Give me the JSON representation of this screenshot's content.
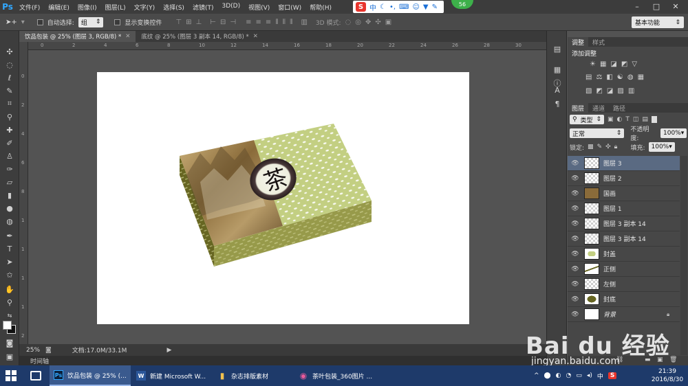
{
  "menubar": {
    "logo": "Ps",
    "items": [
      "文件(F)",
      "编辑(E)",
      "图像(I)",
      "图层(L)",
      "文字(Y)",
      "选择(S)",
      "滤镜(T)",
      "3D(D)",
      "视图(V)",
      "窗口(W)",
      "帮助(H)"
    ],
    "ime": {
      "logo": "S",
      "mode": "中"
    },
    "notification_count": "56",
    "window_controls": [
      "–",
      "□",
      "✕"
    ]
  },
  "options": {
    "auto_select_label": "自动选择:",
    "auto_select_value": "组",
    "show_transform_label": "显示变换控件",
    "mode_3d_label": "3D 模式:",
    "workspace": "基本功能"
  },
  "tabs": [
    {
      "label": "饮品包装 @ 25% (图层 3, RGB/8) *",
      "active": true
    },
    {
      "label": "底纹 @ 25% (图层 3 副本 14, RGB/8) *",
      "active": false
    }
  ],
  "rulers": {
    "top": [
      "0",
      "2",
      "4",
      "6",
      "8",
      "10",
      "12",
      "14",
      "16",
      "18",
      "20",
      "22",
      "24",
      "26",
      "28",
      "30",
      "32"
    ],
    "left": [
      "0",
      "2",
      "4",
      "6",
      "8",
      "1",
      "1",
      "1",
      "1",
      "2"
    ]
  },
  "canvas": {
    "box_lid_color": "#c3cf82",
    "box_side_color": "#676622",
    "box_front_color": "#979a4a",
    "seal_char": "茶"
  },
  "status": {
    "zoom": "25%",
    "doc": "文档:17.0M/33.1M"
  },
  "timeline_label": "时间轴",
  "adjust_panel": {
    "tabs": [
      "调整",
      "样式"
    ],
    "title": "添加调整",
    "row1": [
      "☀",
      "▦",
      "◪",
      "◩",
      "▽"
    ],
    "row2": [
      "▤",
      "⚖",
      "◧",
      "☯",
      "◍",
      "▦"
    ],
    "row3": [
      "▧",
      "◩",
      "◪",
      "▨",
      "▥"
    ]
  },
  "layers_panel": {
    "tabs": [
      "图层",
      "通道",
      "路径"
    ],
    "filter": "类型",
    "blend_mode": "正常",
    "opacity_label": "不透明度:",
    "opacity": "100%",
    "lock_label": "锁定:",
    "fill_label": "填充:",
    "fill": "100%",
    "layers": [
      {
        "name": "图层 3",
        "active": true
      },
      {
        "name": "图层 2",
        "active": false
      },
      {
        "name": "国画",
        "active": false
      },
      {
        "name": "图层 1",
        "active": false
      },
      {
        "name": "图层 3 副本 14",
        "active": false
      },
      {
        "name": "图层 3 副本 14",
        "active": false
      },
      {
        "name": "封盖",
        "active": false
      },
      {
        "name": "正侧",
        "active": false
      },
      {
        "name": "左侧",
        "active": false
      },
      {
        "name": "封底",
        "active": false
      },
      {
        "name": "背景",
        "active": false
      }
    ]
  },
  "taskbar": {
    "tasks": [
      {
        "icon": "Ps",
        "label": "饮品包装 @ 25% (...",
        "active": true
      },
      {
        "icon": "W",
        "label": "新建 Microsoft W...",
        "active": false
      },
      {
        "icon": "▮",
        "label": "杂志排版素材",
        "active": false
      },
      {
        "icon": "◉",
        "label": "茶叶包装_360图片 ...",
        "active": false
      }
    ],
    "tray": [
      "^",
      "⬤",
      "◐",
      "◔",
      "▭",
      "◂)",
      "中",
      "S"
    ],
    "time": "21:39",
    "date": "2016/8/30"
  },
  "watermark": {
    "brand": "Bai du 经验",
    "url": "jingyan.baidu.com"
  }
}
